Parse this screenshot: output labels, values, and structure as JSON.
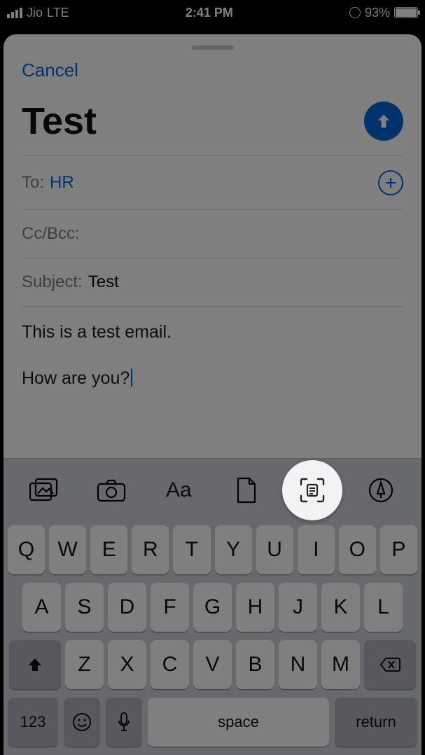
{
  "status": {
    "carrier": "Jio",
    "network": "LTE",
    "time": "2:41 PM",
    "battery_pct": "93%"
  },
  "compose": {
    "cancel": "Cancel",
    "title": "Test",
    "to_label": "To:",
    "to_value": "HR",
    "cc_label": "Cc/Bcc:",
    "subject_label": "Subject:",
    "subject_value": "Test",
    "body_line1": "This is a test email.",
    "body_line2": "How are you?"
  },
  "toolbar": {
    "icons": [
      "gallery-icon",
      "camera-icon",
      "text-format-icon",
      "document-icon",
      "scan-text-icon",
      "markup-icon"
    ],
    "text_format_glyph": "Aa"
  },
  "keyboard": {
    "row1": [
      "Q",
      "W",
      "E",
      "R",
      "T",
      "Y",
      "U",
      "I",
      "O",
      "P"
    ],
    "row2": [
      "A",
      "S",
      "D",
      "F",
      "G",
      "H",
      "J",
      "K",
      "L"
    ],
    "row3": [
      "Z",
      "X",
      "C",
      "V",
      "B",
      "N",
      "M"
    ],
    "numbers_label": "123",
    "space_label": "space",
    "return_label": "return"
  }
}
